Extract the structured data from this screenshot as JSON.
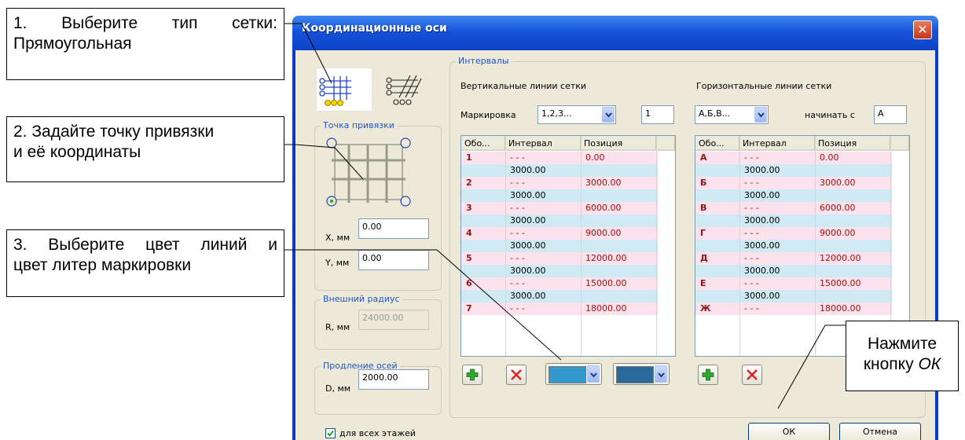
{
  "window": {
    "title": "Координационные оси",
    "close_glyph": "✕"
  },
  "grid_type": {
    "options": [
      "rectangular-grid-icon",
      "skew-grid-icon"
    ]
  },
  "anchor": {
    "legend": "Точка привязки",
    "x_label": "X, мм",
    "x_value": "0.00",
    "y_label": "Y, мм",
    "y_value": "0.00"
  },
  "outer_radius": {
    "legend": "Внешний радиус",
    "r_label": "R, мм",
    "r_value": "24000.00"
  },
  "extension": {
    "legend": "Продление осей",
    "d_label": "D, мм",
    "d_value": "2000.00"
  },
  "all_floors": {
    "label": "для всех этажей",
    "checked": true
  },
  "intervals": {
    "legend": "Интервалы",
    "vertical": {
      "title": "Вертикальные линии сетки",
      "marking_label": "Маркировка",
      "marking_value": "1,2,3...",
      "start_value": "1",
      "columns": [
        "Обо...",
        "Интервал",
        "Позиция"
      ],
      "rows": [
        {
          "mark": "1",
          "interval": "- - -",
          "position": "0.00",
          "between": "3000.00"
        },
        {
          "mark": "2",
          "interval": "- - -",
          "position": "3000.00",
          "between": "3000.00"
        },
        {
          "mark": "3",
          "interval": "- - -",
          "position": "6000.00",
          "between": "3000.00"
        },
        {
          "mark": "4",
          "interval": "- - -",
          "position": "9000.00",
          "between": "3000.00"
        },
        {
          "mark": "5",
          "interval": "- - -",
          "position": "12000.00",
          "between": "3000.00"
        },
        {
          "mark": "6",
          "interval": "- - -",
          "position": "15000.00",
          "between": "3000.00"
        },
        {
          "mark": "7",
          "interval": "- - -",
          "position": "18000.00"
        }
      ]
    },
    "horizontal": {
      "title": "Горизонтальные линии сетки",
      "marking_value": "А,Б,В...",
      "start_label": "начинать с",
      "start_value": "А",
      "columns": [
        "Обо...",
        "Интервал",
        "Позиция"
      ],
      "rows": [
        {
          "mark": "А",
          "interval": "- - -",
          "position": "0.00",
          "between": "3000.00"
        },
        {
          "mark": "Б",
          "interval": "- - -",
          "position": "3000.00",
          "between": "3000.00"
        },
        {
          "mark": "В",
          "interval": "- - -",
          "position": "6000.00",
          "between": "3000.00"
        },
        {
          "mark": "Г",
          "interval": "- - -",
          "position": "9000.00",
          "between": "3000.00"
        },
        {
          "mark": "Д",
          "interval": "- - -",
          "position": "12000.00",
          "between": "3000.00"
        },
        {
          "mark": "Е",
          "interval": "- - -",
          "position": "15000.00",
          "between": "3000.00"
        },
        {
          "mark": "Ж",
          "interval": "- - -",
          "position": "18000.00"
        }
      ]
    },
    "line_color": "#3399cc",
    "label_color": "#2a6a9a"
  },
  "buttons": {
    "ok": "ОК",
    "cancel": "Отмена"
  },
  "callouts": {
    "c1_line1": "1. Выберите тип сетки:",
    "c1_line2": "Прямоугольная",
    "c2_line1": "2. Задайте точку привязки",
    "c2_line2": "и её координаты",
    "c3_line1": "3. Выберите цвет линий и",
    "c3_line2": "цвет литер маркировки",
    "c4_line1": "Нажмите",
    "c4_line2_prefix": "кнопку ",
    "c4_line2_em": "ОК"
  }
}
